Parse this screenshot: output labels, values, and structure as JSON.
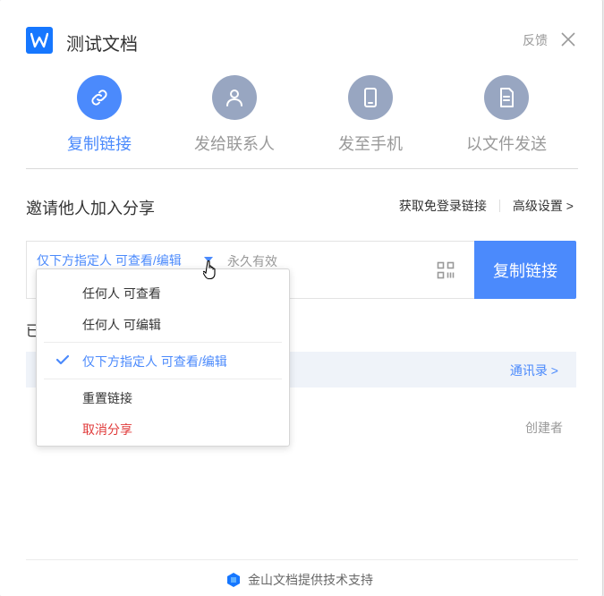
{
  "header": {
    "title": "测试文档",
    "feedback": "反馈"
  },
  "tabs": [
    {
      "label": "复制链接",
      "icon": "link-icon",
      "active": true
    },
    {
      "label": "发给联系人",
      "icon": "user-icon",
      "active": false
    },
    {
      "label": "发至手机",
      "icon": "phone-icon",
      "active": false
    },
    {
      "label": "以文件发送",
      "icon": "file-icon",
      "active": false
    }
  ],
  "invite": {
    "title": "邀请他人加入分享",
    "no_login_link": "获取免登录链接",
    "advanced": "高级设置 >"
  },
  "link": {
    "permission": "仅下方指定人 可查看/编辑",
    "expiry": "永久有效",
    "copy_button": "复制链接"
  },
  "dropdown": {
    "items": [
      {
        "label": "任何人 可查看"
      },
      {
        "label": "任何人 可编辑"
      },
      {
        "label": "仅下方指定人 可查看/编辑",
        "checked": true
      },
      {
        "label": "重置链接"
      },
      {
        "label": "取消分享",
        "danger": true
      }
    ]
  },
  "members": {
    "partial_label": "已",
    "contacts": "通讯录 >",
    "creator": "创建者"
  },
  "footer": {
    "text": "金山文档提供技术支持"
  },
  "colors": {
    "accent": "#4b8afc",
    "inactive_icon": "#98a6c1",
    "danger": "#e03a3a",
    "logo": "#1677ff"
  }
}
